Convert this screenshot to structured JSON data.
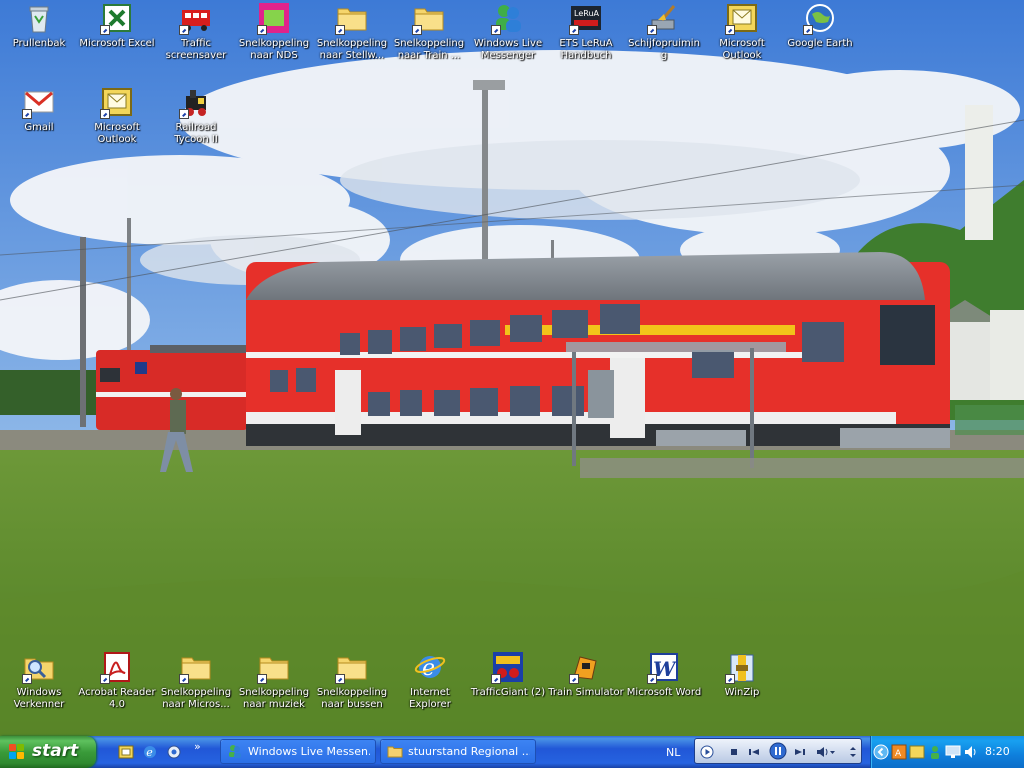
{
  "desktop_icons": [
    {
      "label": "Prullenbak",
      "icon": "recycle-bin-icon",
      "shortcut": false
    },
    {
      "label": "Microsoft Excel",
      "icon": "excel-icon",
      "shortcut": true
    },
    {
      "label": "Traffic screensaver",
      "icon": "tram-icon",
      "shortcut": true
    },
    {
      "label": "Snelkoppeling naar NDS",
      "icon": "nds-icon",
      "shortcut": true
    },
    {
      "label": "Snelkoppeling naar Stellw...",
      "icon": "folder-icon",
      "shortcut": true
    },
    {
      "label": "Snelkoppeling naar Train ...",
      "icon": "folder-icon",
      "shortcut": true
    },
    {
      "label": "Windows Live Messenger",
      "icon": "messenger-icon",
      "shortcut": true
    },
    {
      "label": "ETS LeRuA Handbuch",
      "icon": "lerua-icon",
      "shortcut": true
    },
    {
      "label": "Schijfopruiming",
      "icon": "disk-cleanup-icon",
      "shortcut": true
    },
    {
      "label": "Microsoft Outlook",
      "icon": "outlook-icon",
      "shortcut": true
    },
    {
      "label": "Google Earth",
      "icon": "google-earth-icon",
      "shortcut": true
    },
    {
      "label": "Gmail",
      "icon": "gmail-icon",
      "shortcut": true
    },
    {
      "label": "Microsoft Outlook",
      "icon": "outlook-icon",
      "shortcut": true
    },
    {
      "label": "Railroad Tycoon II",
      "icon": "railroad-tycoon-icon",
      "shortcut": true
    },
    {
      "label": "Windows Verkenner",
      "icon": "explorer-magnifier-icon",
      "shortcut": true
    },
    {
      "label": "Acrobat Reader 4.0",
      "icon": "acrobat-icon",
      "shortcut": true
    },
    {
      "label": "Snelkoppeling naar Micros...",
      "icon": "folder-icon",
      "shortcut": true
    },
    {
      "label": "Snelkoppeling naar muziek",
      "icon": "folder-icon",
      "shortcut": true
    },
    {
      "label": "Snelkoppeling naar bussen",
      "icon": "folder-icon",
      "shortcut": true
    },
    {
      "label": "Internet Explorer",
      "icon": "internet-explorer-icon",
      "shortcut": false
    },
    {
      "label": "TrafficGiant (2)",
      "icon": "trafficgiant-icon",
      "shortcut": true
    },
    {
      "label": "Train Simulator",
      "icon": "train-simulator-icon",
      "shortcut": true
    },
    {
      "label": "Microsoft Word",
      "icon": "word-icon",
      "shortcut": true
    },
    {
      "label": "WinZip",
      "icon": "winzip-icon",
      "shortcut": true
    }
  ],
  "taskbar": {
    "start_label": "start",
    "quick_launch": [
      "outlook-icon",
      "internet-explorer-icon",
      "show-desktop-icon"
    ],
    "overflow_chevron": "»",
    "tasks": [
      {
        "label": "Windows Live Messen...",
        "icon": "messenger-icon"
      },
      {
        "label": "stuurstand Regional ...",
        "icon": "folder-icon"
      }
    ],
    "language": "NL",
    "media_player": {
      "controls": [
        "play-icon",
        "stop-icon",
        "previous-icon",
        "pause-icon",
        "next-icon",
        "volume-icon"
      ]
    },
    "tray_icons": [
      "tray-chevron-icon",
      "tray-app-icon",
      "tray-network-icon",
      "tray-messenger-icon",
      "tray-monitor-icon",
      "tray-speaker-icon",
      "tray-security-icon"
    ],
    "clock": "8:20"
  },
  "colors": {
    "taskbar": "#2157d7",
    "start": "#3a9b3a",
    "tray": "#0e7fdc",
    "train": "#e6302a"
  }
}
